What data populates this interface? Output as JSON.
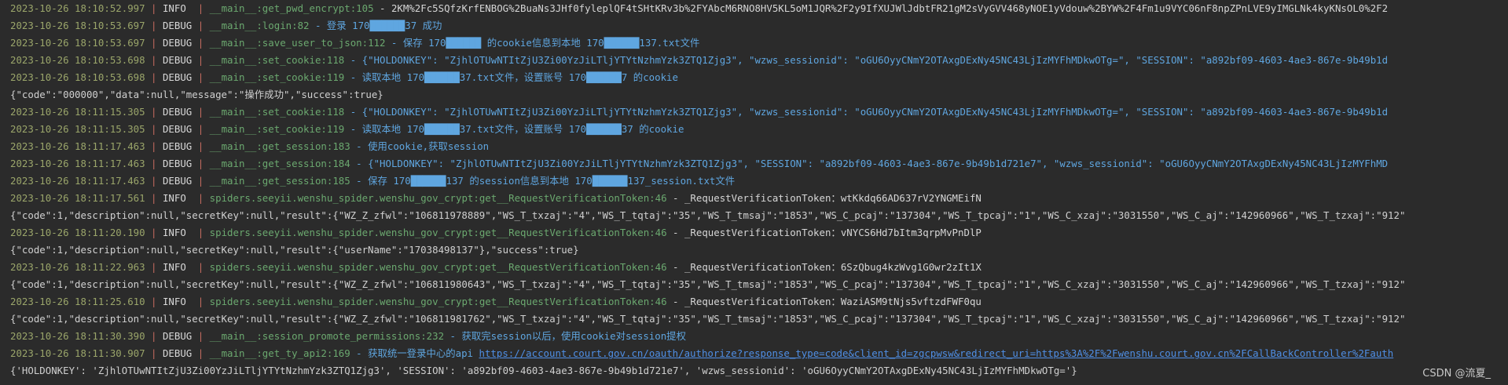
{
  "console": {
    "lines": [
      {
        "ts": "2023-10-26 18:10:52.997",
        "level": "INFO ",
        "module": "__main__:get_pwd_encrypt:105",
        "msg": "2KM%2Fc5SQfzKrfENBOG%2BuaNs3JHf0fyleplQF4tSHtKRv3b%2FYAbcM6RNO8HV5KL5oM1JQR%2F2y9IfXUJWlJdbtFR21gM2sVyGVV468yNOE1yVdouw%2BYW%2F4Fm1u9VYC06nF8npZPnLVE9yIMGLNk4kyKNsOL0%2F2"
      },
      {
        "ts": "2023-10-26 18:10:53.697",
        "level": "DEBUG",
        "module": "__main__:login:82",
        "msg": "登录 170██████37 成功"
      },
      {
        "ts": "2023-10-26 18:10:53.697",
        "level": "DEBUG",
        "module": "__main__:save_user_to_json:112",
        "msg": "保存 170██████ 的cookie信息到本地 170██████137.txt文件"
      },
      {
        "ts": "2023-10-26 18:10:53.698",
        "level": "DEBUG",
        "module": "__main__:set_cookie:118",
        "msg": "{\"HOLDONKEY\": \"ZjhlOTUwNTItZjU3Zi00YzJiLTljYTYtNzhmYzk3ZTQ1Zjg3\", \"wzws_sessionid\": \"oGU6OyyCNmY2OTAxgDExNy45NC43LjIzMYFhMDkwOTg=\", \"SESSION\": \"a892bf09-4603-4ae3-867e-9b49b1d"
      },
      {
        "ts": "2023-10-26 18:10:53.698",
        "level": "DEBUG",
        "module": "__main__:set_cookie:119",
        "msg": "读取本地 170██████37.txt文件，设置账号 170██████7 的cookie"
      },
      {
        "raw": "{\"code\":\"000000\",\"data\":null,\"message\":\"操作成功\",\"success\":true}"
      },
      {
        "ts": "2023-10-26 18:11:15.305",
        "level": "DEBUG",
        "module": "__main__:set_cookie:118",
        "msg": "{\"HOLDONKEY\": \"ZjhlOTUwNTItZjU3Zi00YzJiLTljYTYtNzhmYzk3ZTQ1Zjg3\", \"wzws_sessionid\": \"oGU6OyyCNmY2OTAxgDExNy45NC43LjIzMYFhMDkwOTg=\", \"SESSION\": \"a892bf09-4603-4ae3-867e-9b49b1d"
      },
      {
        "ts": "2023-10-26 18:11:15.305",
        "level": "DEBUG",
        "module": "__main__:set_cookie:119",
        "msg": "读取本地 170██████37.txt文件，设置账号 170██████37 的cookie"
      },
      {
        "ts": "2023-10-26 18:11:17.463",
        "level": "DEBUG",
        "module": "__main__:get_session:183",
        "msg": "使用cookie,获取session"
      },
      {
        "ts": "2023-10-26 18:11:17.463",
        "level": "DEBUG",
        "module": "__main__:get_session:184",
        "msg": "{\"HOLDONKEY\": \"ZjhlOTUwNTItZjU3Zi00YzJiLTljYTYtNzhmYzk3ZTQ1Zjg3\", \"SESSION\": \"a892bf09-4603-4ae3-867e-9b49b1d721e7\", \"wzws_sessionid\": \"oGU6OyyCNmY2OTAxgDExNy45NC43LjIzMYFhMD"
      },
      {
        "ts": "2023-10-26 18:11:17.463",
        "level": "DEBUG",
        "module": "__main__:get_session:185",
        "msg": "保存 170██████137 的session信息到本地 170██████137_session.txt文件"
      },
      {
        "ts": "2023-10-26 18:11:17.561",
        "level": "INFO ",
        "module": "spiders.seeyii.wenshu_spider.wenshu_gov_crypt:get__RequestVerificationToken:46",
        "msg": "_RequestVerificationToken：wtKkdq66AD637rV2YNGMEifN"
      },
      {
        "raw": "{\"code\":1,\"description\":null,\"secretKey\":null,\"result\":{\"WZ_Z_zfwl\":\"106811978889\",\"WS_T_txzaj\":\"4\",\"WS_T_tqtaj\":\"35\",\"WS_T_tmsaj\":\"1853\",\"WS_C_pcaj\":\"137304\",\"WS_T_tpcaj\":\"1\",\"WS_C_xzaj\":\"3031550\",\"WS_C_aj\":\"142960966\",\"WS_T_tzxaj\":\"912\""
      },
      {
        "ts": "2023-10-26 18:11:20.190",
        "level": "INFO ",
        "module": "spiders.seeyii.wenshu_spider.wenshu_gov_crypt:get__RequestVerificationToken:46",
        "msg": "_RequestVerificationToken：vNYCS6Hd7bItm3qrpMvPnDlP"
      },
      {
        "raw": "{\"code\":1,\"description\":null,\"secretKey\":null,\"result\":{\"userName\":\"17038498137\"},\"success\":true}"
      },
      {
        "ts": "2023-10-26 18:11:22.963",
        "level": "INFO ",
        "module": "spiders.seeyii.wenshu_spider.wenshu_gov_crypt:get__RequestVerificationToken:46",
        "msg": "_RequestVerificationToken：6SzQbug4kzWvg1G0wr2zIt1X"
      },
      {
        "raw": "{\"code\":1,\"description\":null,\"secretKey\":null,\"result\":{\"WZ_Z_zfwl\":\"106811980643\",\"WS_T_txzaj\":\"4\",\"WS_T_tqtaj\":\"35\",\"WS_T_tmsaj\":\"1853\",\"WS_C_pcaj\":\"137304\",\"WS_T_tpcaj\":\"1\",\"WS_C_xzaj\":\"3031550\",\"WS_C_aj\":\"142960966\",\"WS_T_tzxaj\":\"912\""
      },
      {
        "ts": "2023-10-26 18:11:25.610",
        "level": "INFO ",
        "module": "spiders.seeyii.wenshu_spider.wenshu_gov_crypt:get__RequestVerificationToken:46",
        "msg": "_RequestVerificationToken：WaziASM9tNjs5vftzdFWF0qu"
      },
      {
        "raw": "{\"code\":1,\"description\":null,\"secretKey\":null,\"result\":{\"WZ_Z_zfwl\":\"106811981762\",\"WS_T_txzaj\":\"4\",\"WS_T_tqtaj\":\"35\",\"WS_T_tmsaj\":\"1853\",\"WS_C_pcaj\":\"137304\",\"WS_T_tpcaj\":\"1\",\"WS_C_xzaj\":\"3031550\",\"WS_C_aj\":\"142960966\",\"WS_T_tzxaj\":\"912\""
      },
      {
        "ts": "2023-10-26 18:11:30.390",
        "level": "DEBUG",
        "module": "__main__:session_promote_permissions:232",
        "msg": "获取完session以后，使用cookie对session提权"
      },
      {
        "ts": "2023-10-26 18:11:30.907",
        "level": "DEBUG",
        "module": "__main__:get_ty_api2:169",
        "msg": "获取统一登录中心的api",
        "link": "https://account.court.gov.cn/oauth/authorize?response_type=code&client_id=zgcpwsw&redirect_uri=https%3A%2F%2Fwenshu.court.gov.cn%2FCallBackController%2Fauth"
      },
      {
        "raw": "{'HOLDONKEY': 'ZjhlOTUwNTItZjU3Zi00YzJiLTljYTYtNzhmYzk3ZTQ1Zjg3', 'SESSION': 'a892bf09-4603-4ae3-867e-9b49b1d721e7', 'wzws_sessionid': 'oGU6OyyCNmY2OTAxgDExNy45NC43LjIzMYFhMDkwOTg='}"
      }
    ],
    "watermark": "CSDN @流夏_"
  }
}
